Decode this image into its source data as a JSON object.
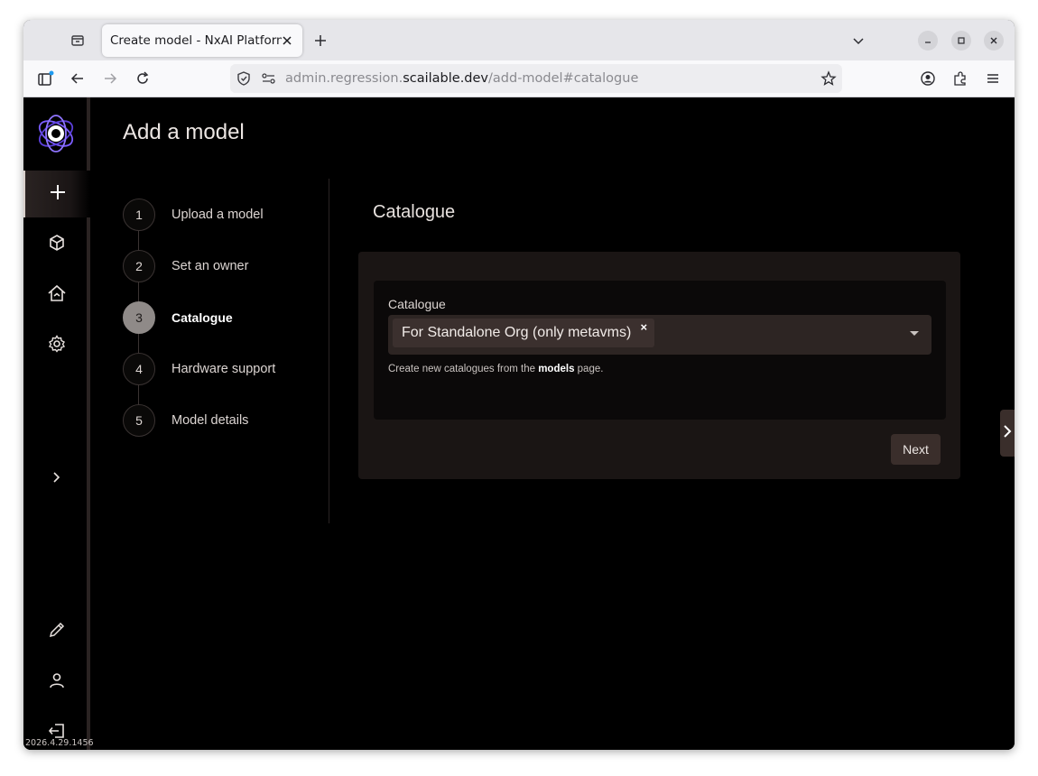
{
  "browser": {
    "tab_title": "Create model - NxAI Platform",
    "url_prefix": "admin.regression.",
    "url_host": "scailable.dev",
    "url_path": "/add-model#catalogue"
  },
  "app": {
    "version": "2026.4.29.1456",
    "page_title": "Add a model",
    "steps": [
      {
        "num": "1",
        "label": "Upload a model"
      },
      {
        "num": "2",
        "label": "Set an owner"
      },
      {
        "num": "3",
        "label": "Catalogue"
      },
      {
        "num": "4",
        "label": "Hardware support"
      },
      {
        "num": "5",
        "label": "Model details"
      }
    ],
    "active_step": 3,
    "section_title": "Catalogue",
    "field_label": "Catalogue",
    "selected_chip": "For Standalone Org (only metavms)",
    "chip_remove": "×",
    "helper_before": "Create new catalogues from the ",
    "helper_link": "models",
    "helper_after": " page.",
    "next_label": "Next"
  },
  "colors": {
    "accent": "#7a5cff",
    "background": "#000000",
    "card": "#1a1514",
    "button": "#3a2e2b"
  }
}
